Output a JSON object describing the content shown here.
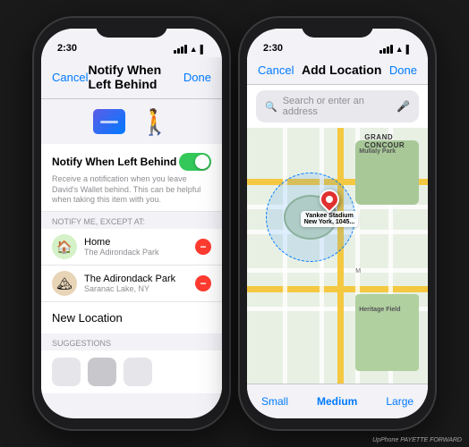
{
  "left_phone": {
    "status_time": "2:30",
    "nav_cancel": "Cancel",
    "nav_title": "Notify When Left Behind",
    "nav_done": "Done",
    "notify_title": "Notify When Left Behind",
    "notify_desc": "Receive a notification when you leave David's Wallet behind. This can be helpful when taking this item with you.",
    "except_label": "NOTIFY ME, EXCEPT AT:",
    "locations": [
      {
        "icon": "🏠",
        "name": "Home",
        "sub": "The Adirondack Park",
        "icon_bg": "#d4f1c7"
      },
      {
        "icon": "🏔",
        "name": "The Adirondack Park",
        "sub": "Saranac Lake, NY",
        "icon_bg": "#e8d5b7"
      }
    ],
    "new_location_text": "New Location",
    "suggestions_label": "SUGGESTIONS"
  },
  "right_phone": {
    "status_time": "2:30",
    "nav_cancel": "Cancel",
    "nav_title": "Add Location",
    "nav_done": "Done",
    "search_placeholder": "Search or enter an address",
    "map": {
      "pin_label_line1": "Yankee Stadium",
      "pin_label_line2": "New York, 1045..."
    },
    "size_options": [
      "Small",
      "Medium",
      "Large"
    ],
    "selected_size": "Medium"
  },
  "watermark": "UpPhone PAYETTE FORWARD"
}
